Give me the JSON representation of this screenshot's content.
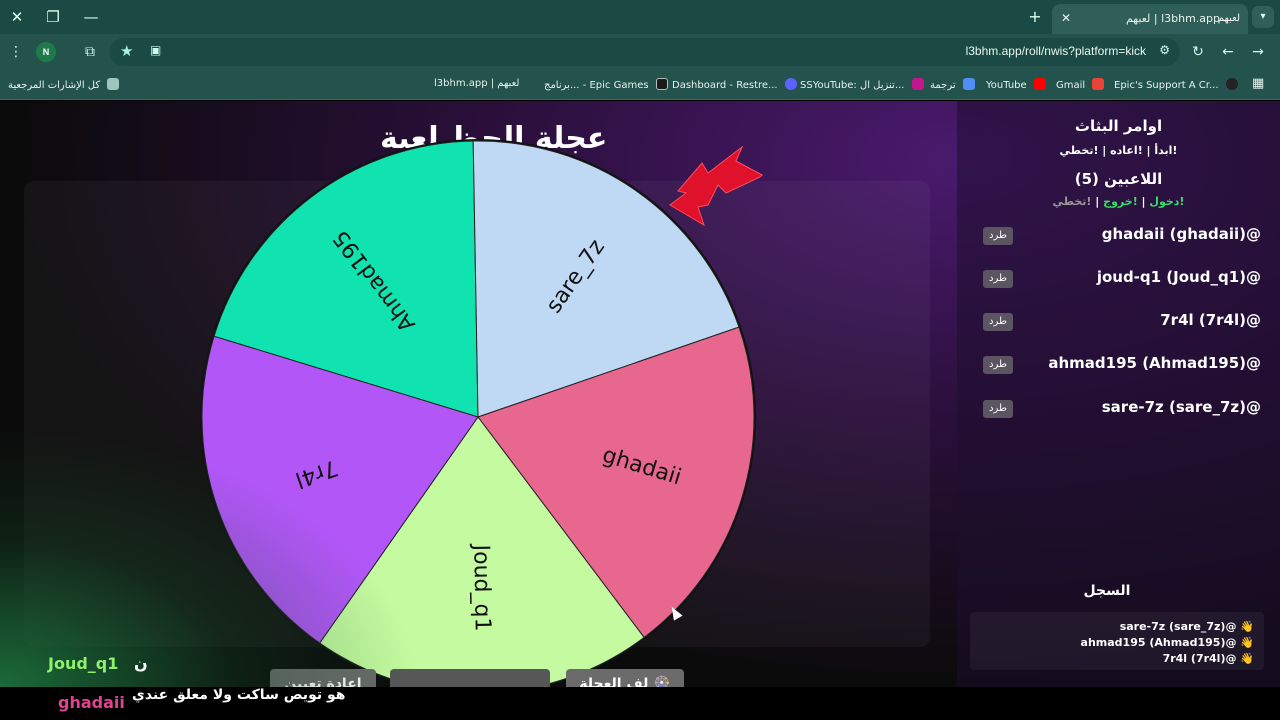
{
  "browser": {
    "tab_title": "l3bhm.app | لعبهم",
    "tab_favicon": "لعبهم",
    "url": "l3bhm.app/roll/nwis?platform=kick",
    "profile_initial": "N",
    "bookmarks": [
      {
        "label": "كل الإشارات المرجعية",
        "color": "#9ec5be"
      },
      {
        "label": "l3bhm.app | لعبهم",
        "color": "#ffffff"
      },
      {
        "label": "برنامج... - Epic Games",
        "color": "#1a1a1a"
      },
      {
        "label": "Dashboard - Restre...",
        "color": "#5a63ff"
      },
      {
        "label": "SSYouTube: تنزيل ال...",
        "color": "#c3158d"
      },
      {
        "label": "ترجمة",
        "color": "#4f8ef7"
      },
      {
        "label": "YouTube",
        "color": "#ff0000"
      },
      {
        "label": "Gmail",
        "color": "#ea4335"
      },
      {
        "label": "Epic's Support A Cr...",
        "color": "#222222"
      }
    ]
  },
  "wheel": {
    "title": "عجلة الحظ لعبة",
    "segments": [
      {
        "label": "Ahmad195",
        "color": "#10e3b0"
      },
      {
        "label": "sare_7z",
        "color": "#bfd9f4"
      },
      {
        "label": "ghadaii",
        "color": "#e8678f"
      },
      {
        "label": "Joud_q1",
        "color": "#c4fba0"
      },
      {
        "label": "7r4l",
        "color": "#b256f8"
      }
    ]
  },
  "buttons": {
    "reset": "إعادة تعيين",
    "spin": "🎡 لف العجلة"
  },
  "sidebar": {
    "title": "اوامر البثاث",
    "commands": "!ابدأ | !اعاده | !تخطي",
    "players_title": "اللاعبين (5)",
    "join": "!دخول",
    "leave": "!خروج",
    "skip": "!تخطي",
    "kick_label": "طرد",
    "players": [
      "ghadaii (ghadaii)@",
      "joud-q1 (Joud_q1)@",
      "7r4l (7r4l)@",
      "ahmad195 (Ahmad195)@",
      "sare-7z (sare_7z)@"
    ],
    "log_title": "السجل",
    "log": [
      "sare-7z (sare_7z)@ 👋",
      "ahmad195 (Ahmad195)@ 👋",
      "7r4l (7r4l)@ 👋"
    ]
  },
  "overlay": {
    "top_user": "Joud_q1",
    "top_letter": "ن",
    "chat_user": "ghadaii",
    "chat_message": "هو تويص ساكت ولا معلق عندي"
  }
}
